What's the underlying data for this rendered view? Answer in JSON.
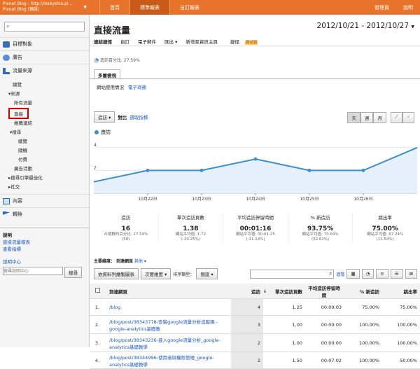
{
  "topbar": {
    "account_line1": "Pixnet Blog - http://losbyshia.pi...",
    "account_line2": "Pixnet Blog (預設)",
    "tabs": [
      "首頁",
      "標準報表",
      "自訂報表"
    ],
    "active_tab": 1,
    "admin": "管理員",
    "help": "說明"
  },
  "sidebar": {
    "sections": [
      {
        "label": "目標對象",
        "icon": "people-icon"
      },
      {
        "label": "廣告",
        "icon": "ads-icon"
      },
      {
        "label": "流量來源",
        "icon": "traffic-icon"
      }
    ],
    "traffic": [
      "總覽",
      "▾來源",
      "所有流量",
      "直接",
      "推薦連結",
      "▾搜尋",
      "總覽",
      "隨機",
      "付費",
      "廣告活動",
      "▸搜尋引擎最佳化",
      "▸社交"
    ],
    "content": "內容",
    "conversions": "轉換",
    "help_title": "說明",
    "help_links": [
      "直接流量報表",
      "查看指標"
    ],
    "help_center": "說明中心",
    "help_placeholder": "搜尋說明中心",
    "help_search": "搜尋"
  },
  "main": {
    "title": "直接流量",
    "date_range": "2012/10/21 - 2012/10/27",
    "toolbar": [
      "連結捷徑",
      "自訂",
      "電子郵件",
      "匯出 ▾",
      "新增至資訊主頁",
      "捷徑"
    ],
    "beta": "測試版",
    "visit_pct": "造訪百分比: 27.59%",
    "tab": "多層檢視",
    "sublinks": [
      "網站使用情況",
      "電子商務"
    ],
    "metric_btn": "造訪",
    "compare": "對比",
    "select_metric": "選取指標",
    "periods": [
      "天",
      "週",
      "月"
    ],
    "chart_legend": "造訪",
    "stats": [
      {
        "name": "造訪",
        "value": "16",
        "sub1": "占總數的百分比: 27.59%",
        "sub2": "(58)"
      },
      {
        "name": "單次造訪頁數",
        "value": "1.38",
        "sub1": "網站平均值: 1.72",
        "sub2": "(-20.25%)"
      },
      {
        "name": "平均造訪停留時間",
        "value": "00:01:16",
        "sub1": "網站平均值: 00:01:25",
        "sub2": "(-11.14%)"
      },
      {
        "name": "% 新造訪",
        "value": "93.75%",
        "sub1": "網站平均值: 70.69%",
        "sub2": "(32.62%)"
      },
      {
        "name": "跳出率",
        "value": "75.00%",
        "sub1": "網站平均值: 67.24%",
        "sub2": "(11.54%)"
      }
    ],
    "dimension_label": "主要維度：",
    "dimension_value": "到達網頁",
    "dimension_other": "其他 ▾",
    "table_controls": [
      "依資料列繪製圖表",
      "次要維度 ▾",
      "排序類型：",
      "預設 ▾"
    ],
    "advanced": "進階",
    "columns": [
      "到達網頁",
      "造訪",
      "↓",
      "單次造訪頁數",
      "平均造訪停留時間",
      "% 新造訪",
      "跳出率"
    ],
    "rows": [
      {
        "n": "1.",
        "page": "/blog",
        "visits": "4",
        "ppv": "1.25",
        "time": "00:00:03",
        "newv": "75.00%",
        "bounce": "75.00%"
      },
      {
        "n": "2.",
        "page": "/blog/post/38343778-安裝google流量分析追蹤碼 - google-analytics基礎教",
        "visits": "3",
        "ppv": "1.00",
        "time": "00:00:00",
        "newv": "100.00%",
        "bounce": "100.00%"
      },
      {
        "n": "3.",
        "page": "/blog/post/38343236-進入google流量分析_google-analytics基礎教學",
        "visits": "2",
        "ppv": "1.00",
        "time": "00:00:00",
        "newv": "100.00%",
        "bounce": "100.00%"
      },
      {
        "n": "4.",
        "page": "/blog/post/38344996-使用者與權限管理_google-analytics基礎教學",
        "visits": "2",
        "ppv": "1.50",
        "time": "00:07:02",
        "newv": "100.00%",
        "bounce": "50.00%"
      }
    ]
  },
  "chart_data": {
    "type": "area",
    "x": [
      "2012/10/21",
      "2012/10/22",
      "2012/10/23",
      "2012/10/24",
      "2012/10/25",
      "2012/10/26",
      "2012/10/27"
    ],
    "xticks": [
      "10月22日",
      "10月23日",
      "10月24日",
      "10月25日",
      "10月26日"
    ],
    "yticks": [
      "4",
      "2"
    ],
    "ylim": [
      0,
      4.6
    ],
    "series": [
      {
        "name": "造訪",
        "values": [
          1,
          2,
          2,
          3,
          2,
          2,
          4
        ]
      }
    ],
    "color": "#3d8ec9"
  }
}
